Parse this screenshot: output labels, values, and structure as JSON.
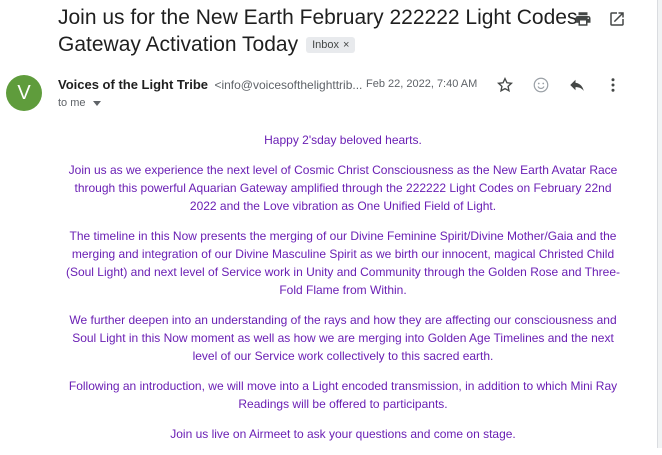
{
  "email": {
    "subject": "Join us for the New Earth February 222222 Light Codes Gateway Activation Today",
    "label_chip": "Inbox",
    "label_chip_close": "×",
    "sender_name": "Voices of the Light Tribe",
    "sender_email": "<info@voicesofthelighttrib...",
    "date": "Feb 22, 2022, 7:40 AM",
    "to_line": "to me",
    "avatar_letter": "V"
  },
  "body": {
    "p1": "Happy 2'sday beloved hearts.",
    "p2": "Join us as we experience the next level of Cosmic Christ Consciousness as the New Earth Avatar Race through this powerful Aquarian Gateway amplified through the 222222 Light Codes on February 22nd 2022 and the Love vibration as One Unified Field of Light.",
    "p3": "The timeline in this Now presents the merging of our Divine Feminine Spirit/Divine Mother/Gaia and the merging and integration of our Divine Masculine Spirit as we birth our innocent, magical Christed Child (Soul Light) and next level of Service work in Unity and Community through the Golden Rose and Three-Fold Flame from Within.",
    "p4": "We further deepen into an understanding of the rays and how they are affecting our consciousness and Soul Light in this Now moment as well as how we are merging into Golden Age Timelines and the next level of our Service work collectively to this sacred earth.",
    "p5": "Following an introduction, we will move into a Light encoded transmission, in addition to which Mini Ray Readings will be offered to participants.",
    "p6": "Join us live on Airmeet to ask your questions and come on stage."
  },
  "icons": [
    "print-icon",
    "open-in-new-window-icon",
    "star-icon",
    "emoji-icon",
    "reply-icon",
    "more-vert-icon"
  ],
  "colors": {
    "body_text": "#6a1fb4",
    "avatar": "#5f9c3c",
    "chip_bg": "#e8eaed"
  }
}
